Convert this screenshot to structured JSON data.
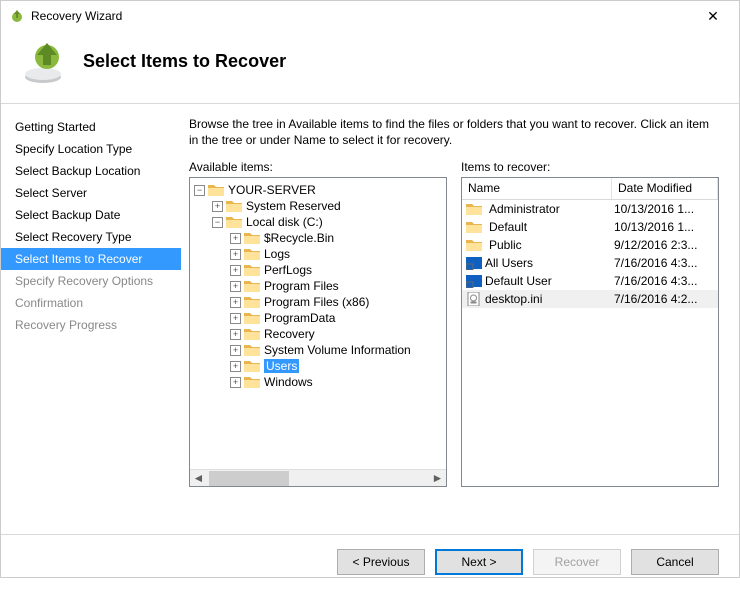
{
  "window": {
    "title": "Recovery Wizard"
  },
  "banner": {
    "title": "Select Items to Recover"
  },
  "nav": {
    "items": [
      {
        "label": "Getting Started",
        "state": "normal"
      },
      {
        "label": "Specify Location Type",
        "state": "normal"
      },
      {
        "label": "Select Backup Location",
        "state": "normal"
      },
      {
        "label": "Select Server",
        "state": "normal"
      },
      {
        "label": "Select Backup Date",
        "state": "normal"
      },
      {
        "label": "Select Recovery Type",
        "state": "normal"
      },
      {
        "label": "Select Items to Recover",
        "state": "selected"
      },
      {
        "label": "Specify Recovery Options",
        "state": "disabled"
      },
      {
        "label": "Confirmation",
        "state": "disabled"
      },
      {
        "label": "Recovery Progress",
        "state": "disabled"
      }
    ]
  },
  "content": {
    "description": "Browse the tree in Available items to find the files or folders that you want to recover. Click an item in the tree or under Name to select it for recovery.",
    "left_label": "Available items:",
    "right_label": "Items to recover:"
  },
  "tree": {
    "root": {
      "label": "YOUR-SERVER",
      "toggle": "-"
    },
    "l1": [
      {
        "label": "System Reserved",
        "toggle": "+"
      },
      {
        "label": "Local disk (C:)",
        "toggle": "-"
      }
    ],
    "c_children": [
      {
        "label": "$Recycle.Bin",
        "toggle": "+"
      },
      {
        "label": "Logs",
        "toggle": "+"
      },
      {
        "label": "PerfLogs",
        "toggle": "+"
      },
      {
        "label": "Program Files",
        "toggle": "+"
      },
      {
        "label": "Program Files (x86)",
        "toggle": "+"
      },
      {
        "label": "ProgramData",
        "toggle": "+"
      },
      {
        "label": "Recovery",
        "toggle": "+"
      },
      {
        "label": "System Volume Information",
        "toggle": "+"
      },
      {
        "label": "Users",
        "toggle": "+",
        "selected": true
      },
      {
        "label": "Windows",
        "toggle": "+"
      }
    ],
    "toggle_minus": "−",
    "toggle_plus": "+"
  },
  "list": {
    "col_name": "Name",
    "col_date": "Date Modified",
    "rows": [
      {
        "name": "Administrator",
        "date": "10/13/2016 1...",
        "icon": "folder"
      },
      {
        "name": "Default",
        "date": "10/13/2016 1...",
        "icon": "folder"
      },
      {
        "name": "Public",
        "date": "9/12/2016 2:3...",
        "icon": "folder"
      },
      {
        "name": "All Users",
        "date": "7/16/2016 4:3...",
        "icon": "shortcut"
      },
      {
        "name": "Default User",
        "date": "7/16/2016 4:3...",
        "icon": "shortcut"
      },
      {
        "name": "desktop.ini",
        "date": "7/16/2016 4:2...",
        "icon": "file"
      }
    ]
  },
  "buttons": {
    "previous": "< Previous",
    "next": "Next >",
    "recover": "Recover",
    "cancel": "Cancel"
  }
}
